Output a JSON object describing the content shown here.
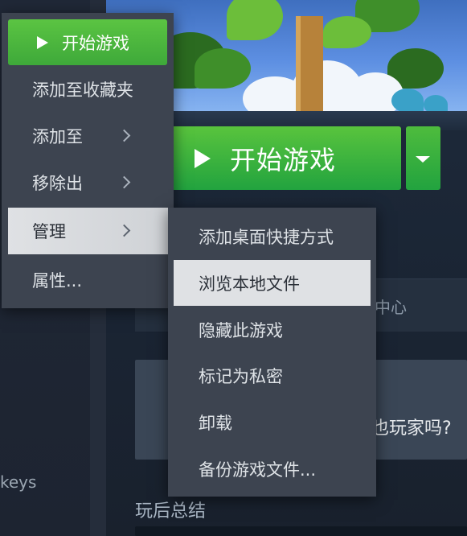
{
  "background": {
    "play_button_label": "开始游戏",
    "support_partial": "中心",
    "recommend_partial": "也玩家吗?",
    "review_title": "玩后总结",
    "sidebar_partial": "keys"
  },
  "context_menu": {
    "items": [
      {
        "label": "开始游戏",
        "highlighted": true
      },
      {
        "label": "添加至收藏夹",
        "has_submenu": false
      },
      {
        "label": "添加至",
        "has_submenu": true
      },
      {
        "label": "移除出",
        "has_submenu": true
      },
      {
        "label": "管理",
        "has_submenu": true,
        "hovered": true
      },
      {
        "label": "属性...",
        "has_submenu": false
      }
    ]
  },
  "manage_submenu": {
    "items": [
      {
        "label": "添加桌面快捷方式"
      },
      {
        "label": "浏览本地文件",
        "hovered": true
      },
      {
        "label": "隐藏此游戏"
      },
      {
        "label": "标记为私密"
      },
      {
        "label": "卸载"
      },
      {
        "label": "备份游戏文件..."
      }
    ]
  },
  "colors": {
    "accent_green": "#3ea93a",
    "menu_bg": "#3d4450",
    "hover_bg": "#dfe1e4"
  },
  "icons": {
    "play": "play-icon",
    "dropdown": "chevron-down-icon",
    "submenu": "chevron-right-icon"
  }
}
